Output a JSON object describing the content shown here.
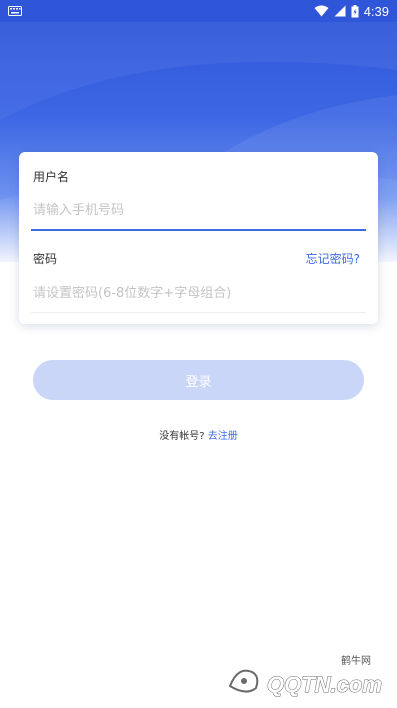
{
  "status_bar": {
    "time": "4:39",
    "icons": [
      "keyboard-icon",
      "wifi-icon",
      "signal-icon",
      "battery-icon"
    ]
  },
  "colors": {
    "primary": "#3f6ae6",
    "header_top": "#2d53d8",
    "button_disabled": "#c9d6f8"
  },
  "form": {
    "username_label": "用户名",
    "username_placeholder": "请输入手机号码",
    "username_value": "",
    "password_label": "密码",
    "password_placeholder": "请设置密码(6-8位数字+字母组合)",
    "password_value": "",
    "forgot_label": "忘记密码?"
  },
  "login_button": "登录",
  "register": {
    "prompt": "没有帐号?",
    "link": "去注册"
  },
  "watermark": {
    "text": "鹤牛网",
    "logo_text": "QQTN.com"
  }
}
